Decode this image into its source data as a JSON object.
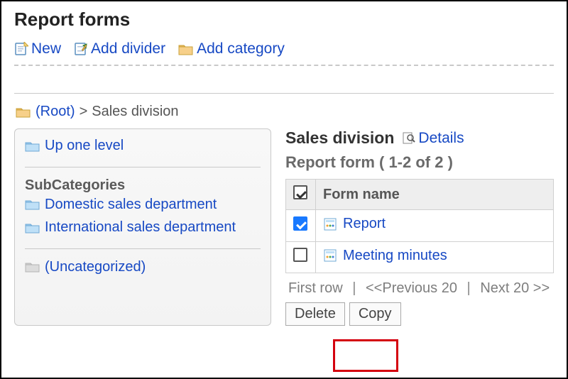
{
  "page": {
    "title": "Report forms"
  },
  "toolbar": {
    "new_label": "New",
    "add_divider_label": "Add divider",
    "add_category_label": "Add category"
  },
  "breadcrumb": {
    "root_label": "(Root)",
    "separator": ">",
    "current": "Sales division"
  },
  "sidebar": {
    "up_label": "Up one level",
    "subhead": "SubCategories",
    "items": [
      {
        "label": "Domestic sales department"
      },
      {
        "label": "International sales department"
      }
    ],
    "uncategorized_label": "(Uncategorized)"
  },
  "main": {
    "category_name": "Sales division",
    "details_label": "Details",
    "list_heading": "Report form ( 1-2 of 2 )",
    "col_formname": "Form name",
    "rows": [
      {
        "label": "Report",
        "checked": true
      },
      {
        "label": "Meeting minutes",
        "checked": false
      }
    ],
    "pager": {
      "first": "First row",
      "prev": "<<Previous 20",
      "next": "Next 20 >>",
      "sep": "|"
    },
    "buttons": {
      "delete": "Delete",
      "copy": "Copy"
    }
  }
}
